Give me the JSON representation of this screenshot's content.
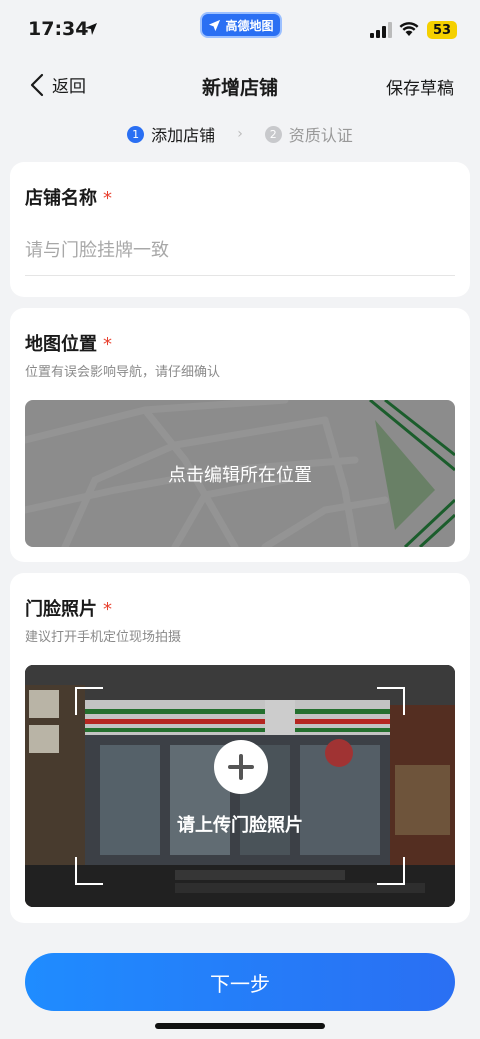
{
  "status_bar": {
    "time": "17:34",
    "app_name": "高德地图",
    "battery": "53"
  },
  "nav": {
    "back_label": "返回",
    "title": "新增店铺",
    "save_draft": "保存草稿"
  },
  "steps": [
    {
      "num": "1",
      "label": "添加店铺"
    },
    {
      "num": "2",
      "label": "资质认证"
    }
  ],
  "store_name": {
    "title": "店铺名称",
    "required_mark": "*",
    "placeholder": "请与门脸挂牌一致"
  },
  "map_section": {
    "title": "地图位置",
    "required_mark": "*",
    "subtitle": "位置有误会影响导航，请仔细确认",
    "overlay_text": "点击编辑所在位置"
  },
  "photo_section": {
    "title": "门脸照片",
    "required_mark": "*",
    "subtitle": "建议打开手机定位现场拍摄",
    "upload_text": "请上传门脸照片"
  },
  "footer": {
    "next_label": "下一步"
  },
  "colors": {
    "accent": "#2a6ff3",
    "required": "#e8412f",
    "battery": "#f5d000"
  }
}
